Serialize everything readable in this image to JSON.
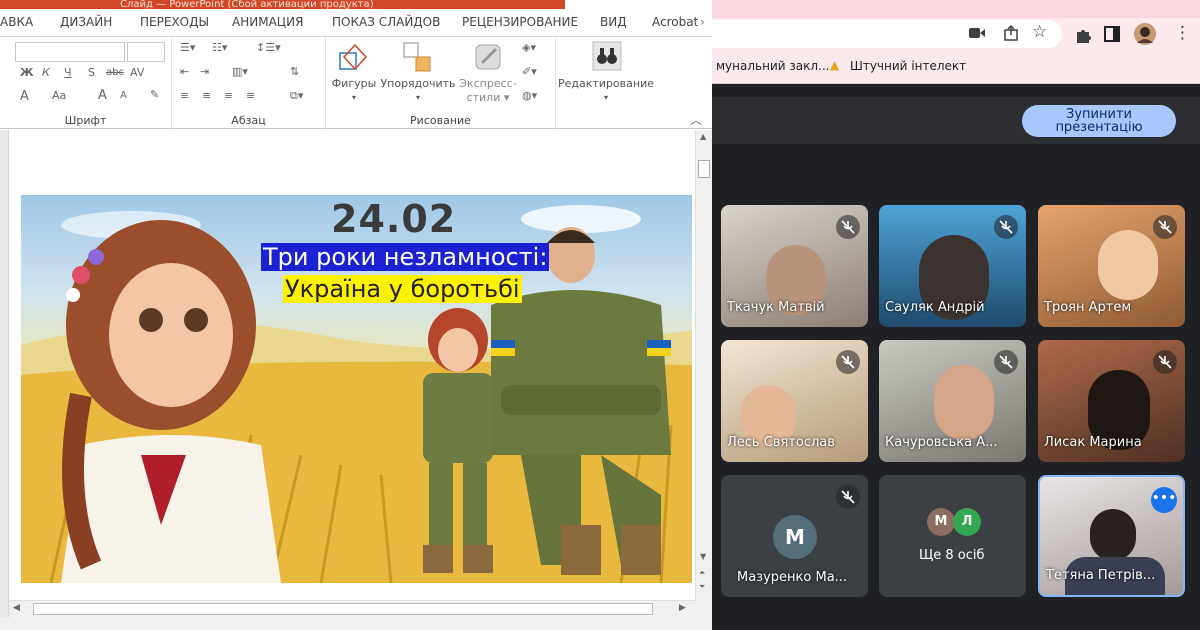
{
  "ppt": {
    "title_text": "Слайд — PowerPoint (Сбой активации продукта)",
    "tabs": [
      "АВКА",
      "ДИЗАЙН",
      "ПЕРЕХОДЫ",
      "АНИМАЦИЯ",
      "ПОКАЗ СЛАЙДОВ",
      "РЕЦЕНЗИРОВАНИЕ",
      "ВИД",
      "Acrobat"
    ],
    "groups": {
      "font": "Шрифт",
      "paragraph": "Абзац",
      "drawing": "Рисование"
    },
    "buttons": {
      "shapes": "Фигуры",
      "arrange": "Упорядочить",
      "quick_styles_1": "Экспресс-",
      "quick_styles_2": "стили",
      "editing": "Редактирование"
    },
    "font_tools": [
      "Ж",
      "К",
      "Ч",
      "S",
      "abc",
      "AV",
      "A",
      "Aa",
      "A",
      "A"
    ],
    "slide": {
      "date": "24.02",
      "line1": "Три роки незламності:",
      "line2": "Україна у боротьбі"
    }
  },
  "chrome": {
    "bookmarks": [
      "мунальний закл...",
      "Штучний інтелект"
    ],
    "stop_button": [
      "Зупинити",
      "презентацію"
    ]
  },
  "meet": {
    "participants": [
      {
        "name": "Ткачук Матвій",
        "muted": true
      },
      {
        "name": "Сауляк Андрій",
        "muted": true
      },
      {
        "name": "Троян Артем",
        "muted": true
      },
      {
        "name": "Лесь Святослав",
        "muted": true
      },
      {
        "name": "Качуровська А...",
        "muted": true
      },
      {
        "name": "Лисак Марина",
        "muted": true
      },
      {
        "name": "Мазуренко Ма...",
        "muted": true,
        "avatar": "М"
      },
      {
        "name": "Ще 8 осіб",
        "avatars": [
          "М",
          "Л"
        ]
      },
      {
        "name": "Тетяна Петрів...",
        "active": true
      }
    ]
  },
  "colors": {
    "ppt_accent": "#d24726",
    "chrome_tabstrip": "#f8d7de",
    "meet_bg": "#202124",
    "stop_button": "#a8c7fa",
    "avatar_m": "#546e7a",
    "avatar_l": "#33a852",
    "avatar_m_small": "#8d6e63",
    "active_border": "#8ab4f8"
  }
}
